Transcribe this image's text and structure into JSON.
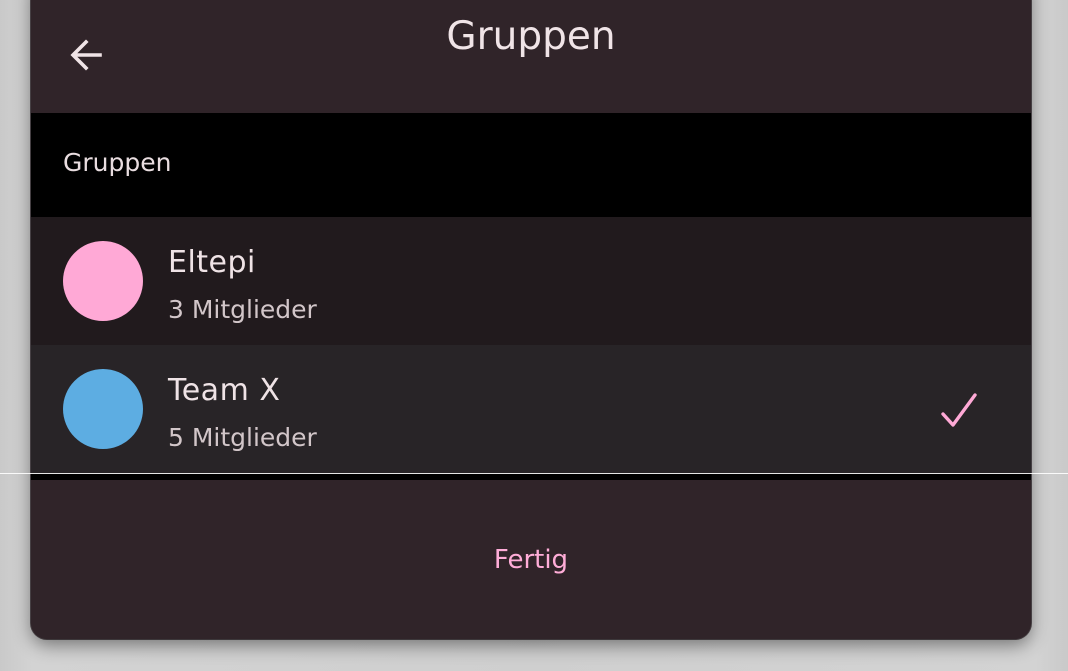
{
  "app_bar": {
    "title": "Gruppen",
    "back_icon": "arrow-left-icon"
  },
  "section": {
    "label": "Gruppen"
  },
  "groups": [
    {
      "name": "Eltepi",
      "members": "3 Mitglieder",
      "color": "#FFA9D6",
      "selected": false
    },
    {
      "name": "Team X",
      "members": "5 Mitglieder",
      "color": "#5DADE2",
      "selected": true
    }
  ],
  "footer": {
    "done_label": "Fertig"
  },
  "colors": {
    "surface": "#302429",
    "accent": "#FFADD8",
    "check": "#FFA9D6"
  },
  "icons": {
    "check": "check-icon"
  }
}
